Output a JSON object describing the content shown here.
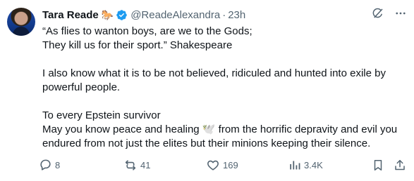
{
  "tweet": {
    "author_name": "Tara Reade",
    "name_emoji": "🐎",
    "handle": "@ReadeAlexandra",
    "separator": "·",
    "time": "23h",
    "lines": [
      "“As flies to wanton boys, are we to the Gods;",
      "They kill us for their sport.” Shakespeare",
      "I also know what it is to be not believed, ridiculed and hunted into exile by",
      "powerful people.",
      "To every Epstein survivor",
      "May you know peace and healing ",
      " from the horrific depravity and evil you",
      "endured from not just the elites but their minions keeping their silence."
    ],
    "dove_emoji": "🕊️"
  },
  "actions": {
    "replies": "8",
    "reposts": "41",
    "likes": "169",
    "views": "3.4K"
  },
  "icons": {
    "verified": "verified-badge-icon",
    "grok": "grok-icon",
    "more": "more-icon",
    "reply": "reply-icon",
    "repost": "repost-icon",
    "like": "like-icon",
    "views": "views-icon",
    "bookmark": "bookmark-icon",
    "share": "share-icon"
  },
  "colors": {
    "verified": "#1d9bf0",
    "text": "#0f1419",
    "secondary": "#536471"
  }
}
